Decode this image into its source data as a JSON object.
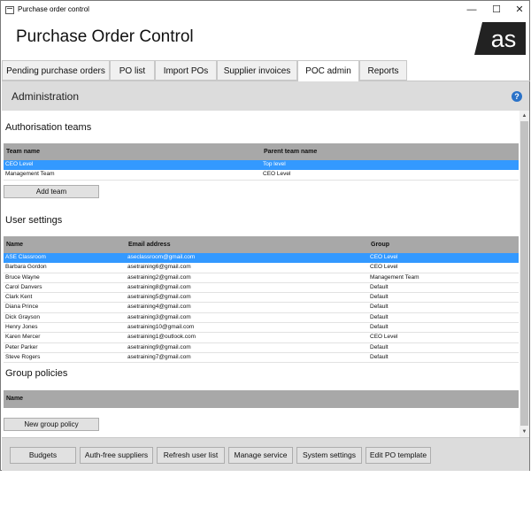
{
  "window": {
    "title": "Purchase order control",
    "minimize": "—",
    "maximize": "☐",
    "close": "✕"
  },
  "app": {
    "title": "Purchase Order Control",
    "logo_text": "as"
  },
  "tabs": [
    "Pending purchase orders",
    "PO list",
    "Import POs",
    "Supplier invoices",
    "POC admin",
    "Reports"
  ],
  "active_tab": "POC admin",
  "section": {
    "title": "Administration",
    "help": "?"
  },
  "auth_teams": {
    "title": "Authorisation teams",
    "columns": [
      "Team name",
      "Parent team name"
    ],
    "rows": [
      [
        "CEO Level",
        "Top level"
      ],
      [
        "Management Team",
        "CEO Level"
      ]
    ],
    "selected_row": 0,
    "add_button": "Add team"
  },
  "user_settings": {
    "title": "User settings",
    "columns": [
      "Name",
      "Email address",
      "Group"
    ],
    "rows": [
      [
        "ASE Classroom",
        "aseclassroom@gmail.com",
        "CEO Level"
      ],
      [
        "Barbara Gordon",
        "asetraining6@gmail.com",
        "CEO Level"
      ],
      [
        "Bruce Wayne",
        "asetraining2@gmail.com",
        "Management Team"
      ],
      [
        "Carol Danvers",
        "asetraining8@gmail.com",
        "Default"
      ],
      [
        "Clark Kent",
        "asetraining5@gmail.com",
        "Default"
      ],
      [
        "Diana Prince",
        "asetraining4@gmail.com",
        "Default"
      ],
      [
        "Dick Grayson",
        "asetraining3@gmail.com",
        "Default"
      ],
      [
        "Henry Jones",
        "asetraining10@gmail.com",
        "Default"
      ],
      [
        "Karen Mercer",
        "asetraining1@outlook.com",
        "CEO Level"
      ],
      [
        "Peter Parker",
        "asetraining9@gmail.com",
        "Default"
      ],
      [
        "Steve Rogers",
        "asetraining7@gmail.com",
        "Default"
      ]
    ],
    "selected_row": 0
  },
  "group_policies": {
    "title": "Group policies",
    "columns": [
      "Name"
    ],
    "new_button": "New group policy"
  },
  "footer_buttons": [
    "Budgets",
    "Auth-free suppliers",
    "Refresh user list",
    "Manage service",
    "System settings",
    "Edit PO template"
  ],
  "colors": {
    "selection": "#3399ff",
    "grid_header": "#a8a8a8",
    "section_bg": "#dcdcdc",
    "logo_bg": "#222222"
  }
}
